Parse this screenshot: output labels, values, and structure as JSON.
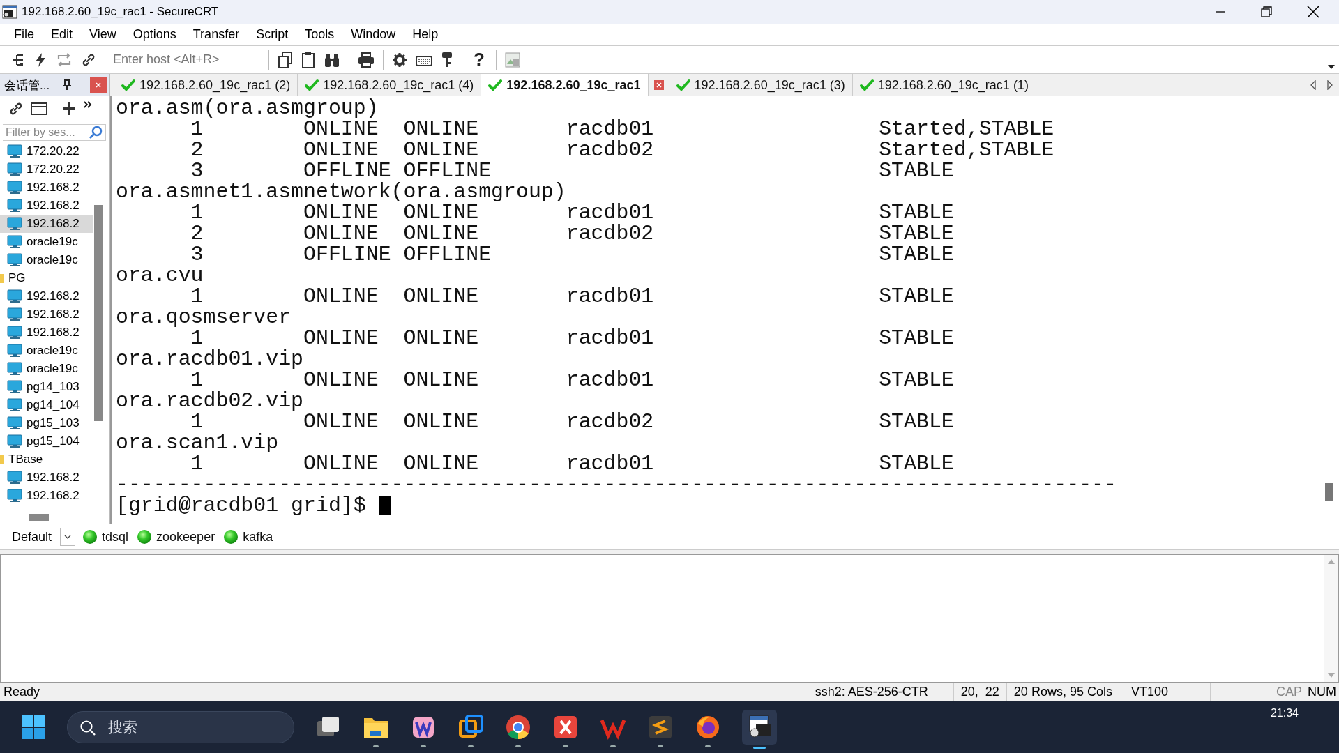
{
  "window": {
    "title": "192.168.2.60_19c_rac1 - SecureCRT"
  },
  "menu": [
    "File",
    "Edit",
    "View",
    "Options",
    "Transfer",
    "Script",
    "Tools",
    "Window",
    "Help"
  ],
  "toolbar": {
    "host_placeholder": "Enter host <Alt+R>",
    "help_glyph": "?"
  },
  "session_manager": {
    "title": "会话管...",
    "filter_placeholder": "Filter by ses...",
    "items": [
      {
        "kind": "session",
        "label": "172.20.22",
        "selected": false
      },
      {
        "kind": "session",
        "label": "172.20.22",
        "selected": false
      },
      {
        "kind": "session",
        "label": "192.168.2",
        "selected": false
      },
      {
        "kind": "session",
        "label": "192.168.2",
        "selected": false
      },
      {
        "kind": "session",
        "label": "192.168.2",
        "selected": true
      },
      {
        "kind": "session",
        "label": "oracle19c",
        "selected": false
      },
      {
        "kind": "session",
        "label": "oracle19c",
        "selected": false
      },
      {
        "kind": "folder",
        "label": "PG",
        "selected": false,
        "children": [
          {
            "kind": "session",
            "label": "192.168.2",
            "selected": false
          },
          {
            "kind": "session",
            "label": "192.168.2",
            "selected": false
          },
          {
            "kind": "session",
            "label": "192.168.2",
            "selected": false
          },
          {
            "kind": "session",
            "label": "oracle19c",
            "selected": false
          },
          {
            "kind": "session",
            "label": "oracle19c",
            "selected": false
          },
          {
            "kind": "session",
            "label": "pg14_103",
            "selected": false
          },
          {
            "kind": "session",
            "label": "pg14_104",
            "selected": false
          },
          {
            "kind": "session",
            "label": "pg15_103",
            "selected": false
          },
          {
            "kind": "session",
            "label": "pg15_104",
            "selected": false
          }
        ]
      },
      {
        "kind": "folder",
        "label": "TBase",
        "selected": false,
        "children": [
          {
            "kind": "session",
            "label": "192.168.2",
            "selected": false
          },
          {
            "kind": "session",
            "label": "192.168.2",
            "selected": false
          }
        ]
      }
    ]
  },
  "tabs": [
    {
      "label": "192.168.2.60_19c_rac1 (2)",
      "selected": false,
      "connected": true
    },
    {
      "label": "192.168.2.60_19c_rac1 (4)",
      "selected": false,
      "connected": true
    },
    {
      "label": "192.168.2.60_19c_rac1",
      "selected": true,
      "connected": true
    },
    {
      "label": "192.168.2.60_19c_rac1 (3)",
      "selected": false,
      "connected": true
    },
    {
      "label": "192.168.2.60_19c_rac1 (1)",
      "selected": false,
      "connected": true
    }
  ],
  "terminal": {
    "cursor": true,
    "lines": [
      "ora.asm(ora.asmgroup)",
      "      1        ONLINE  ONLINE       racdb01                  Started,STABLE",
      "      2        ONLINE  ONLINE       racdb02                  Started,STABLE",
      "      3        OFFLINE OFFLINE                               STABLE",
      "ora.asmnet1.asmnetwork(ora.asmgroup)",
      "      1        ONLINE  ONLINE       racdb01                  STABLE",
      "      2        ONLINE  ONLINE       racdb02                  STABLE",
      "      3        OFFLINE OFFLINE                               STABLE",
      "ora.cvu",
      "      1        ONLINE  ONLINE       racdb01                  STABLE",
      "ora.qosmserver",
      "      1        ONLINE  ONLINE       racdb01                  STABLE",
      "ora.racdb01.vip",
      "      1        ONLINE  ONLINE       racdb01                  STABLE",
      "ora.racdb02.vip",
      "      1        ONLINE  ONLINE       racdb02                  STABLE",
      "ora.scan1.vip",
      "      1        ONLINE  ONLINE       racdb01                  STABLE",
      "--------------------------------------------------------------------------------",
      "[grid@racdb01 grid]$"
    ]
  },
  "button_bar": {
    "group": "Default",
    "buttons": [
      "tdsql",
      "zookeeper",
      "kafka"
    ]
  },
  "status_bar": {
    "message": "Ready",
    "cipher": "ssh2: AES-256-CTR",
    "position": "20,  22",
    "size": "20 Rows, 95 Cols",
    "emulation": "VT100",
    "indicators": [
      {
        "label": "CAP",
        "on": false
      },
      {
        "label": "NUM",
        "on": true
      }
    ]
  },
  "taskbar": {
    "search_placeholder": "搜索",
    "clock": "21:34"
  }
}
